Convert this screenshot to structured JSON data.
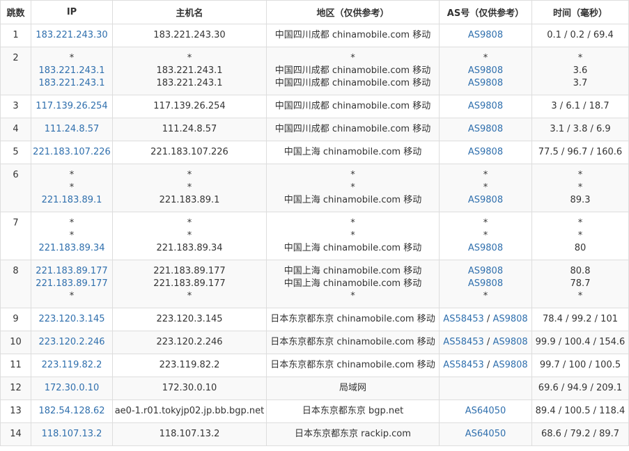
{
  "header": {
    "hop": "跳数",
    "ip": "IP",
    "host": "主机名",
    "region": "地区（仅供参考）",
    "as": "AS号（仅供参考）",
    "time": "时间（毫秒）"
  },
  "rows": [
    {
      "hop": "1",
      "lines": [
        {
          "ip": "183.221.243.30",
          "host": "183.221.243.30",
          "region": "中国四川成都 chinamobile.com 移动",
          "as": [
            "AS9808"
          ],
          "time": "0.1 / 0.2 / 69.4"
        }
      ]
    },
    {
      "hop": "2",
      "lines": [
        {
          "ip": "*",
          "host": "*",
          "region": "*",
          "as": [
            "*"
          ],
          "time": "*"
        },
        {
          "ip": "183.221.243.1",
          "host": "183.221.243.1",
          "region": "中国四川成都 chinamobile.com 移动",
          "as": [
            "AS9808"
          ],
          "time": "3.6"
        },
        {
          "ip": "183.221.243.1",
          "host": "183.221.243.1",
          "region": "中国四川成都 chinamobile.com 移动",
          "as": [
            "AS9808"
          ],
          "time": "3.7"
        }
      ]
    },
    {
      "hop": "3",
      "lines": [
        {
          "ip": "117.139.26.254",
          "host": "117.139.26.254",
          "region": "中国四川成都 chinamobile.com 移动",
          "as": [
            "AS9808"
          ],
          "time": "3 / 6.1 / 18.7"
        }
      ]
    },
    {
      "hop": "4",
      "lines": [
        {
          "ip": "111.24.8.57",
          "host": "111.24.8.57",
          "region": "中国四川成都 chinamobile.com 移动",
          "as": [
            "AS9808"
          ],
          "time": "3.1 / 3.8 / 6.9"
        }
      ]
    },
    {
      "hop": "5",
      "lines": [
        {
          "ip": "221.183.107.226",
          "host": "221.183.107.226",
          "region": "中国上海 chinamobile.com 移动",
          "as": [
            "AS9808"
          ],
          "time": "77.5 / 96.7 / 160.6"
        }
      ]
    },
    {
      "hop": "6",
      "lines": [
        {
          "ip": "*",
          "host": "*",
          "region": "*",
          "as": [
            "*"
          ],
          "time": "*"
        },
        {
          "ip": "*",
          "host": "*",
          "region": "*",
          "as": [
            "*"
          ],
          "time": "*"
        },
        {
          "ip": "221.183.89.1",
          "host": "221.183.89.1",
          "region": "中国上海 chinamobile.com 移动",
          "as": [
            "AS9808"
          ],
          "time": "89.3"
        }
      ]
    },
    {
      "hop": "7",
      "lines": [
        {
          "ip": "*",
          "host": "*",
          "region": "*",
          "as": [
            "*"
          ],
          "time": "*"
        },
        {
          "ip": "*",
          "host": "*",
          "region": "*",
          "as": [
            "*"
          ],
          "time": "*"
        },
        {
          "ip": "221.183.89.34",
          "host": "221.183.89.34",
          "region": "中国上海 chinamobile.com 移动",
          "as": [
            "AS9808"
          ],
          "time": "80"
        }
      ]
    },
    {
      "hop": "8",
      "lines": [
        {
          "ip": "221.183.89.177",
          "host": "221.183.89.177",
          "region": "中国上海 chinamobile.com 移动",
          "as": [
            "AS9808"
          ],
          "time": "80.8"
        },
        {
          "ip": "221.183.89.177",
          "host": "221.183.89.177",
          "region": "中国上海 chinamobile.com 移动",
          "as": [
            "AS9808"
          ],
          "time": "78.7"
        },
        {
          "ip": "*",
          "host": "*",
          "region": "*",
          "as": [
            "*"
          ],
          "time": "*"
        }
      ]
    },
    {
      "hop": "9",
      "lines": [
        {
          "ip": "223.120.3.145",
          "host": "223.120.3.145",
          "region": "日本东京都东京 chinamobile.com 移动",
          "as": [
            "AS58453",
            "AS9808"
          ],
          "time": "78.4 / 99.2 / 101"
        }
      ]
    },
    {
      "hop": "10",
      "lines": [
        {
          "ip": "223.120.2.246",
          "host": "223.120.2.246",
          "region": "日本东京都东京 chinamobile.com 移动",
          "as": [
            "AS58453",
            "AS9808"
          ],
          "time": "99.9 / 100.4 / 154.6"
        }
      ]
    },
    {
      "hop": "11",
      "lines": [
        {
          "ip": "223.119.82.2",
          "host": "223.119.82.2",
          "region": "日本东京都东京 chinamobile.com 移动",
          "as": [
            "AS58453",
            "AS9808"
          ],
          "time": "99.7 / 100 / 100.5"
        }
      ]
    },
    {
      "hop": "12",
      "lines": [
        {
          "ip": "172.30.0.10",
          "host": "172.30.0.10",
          "region": "局域网",
          "as": [],
          "time": "69.6 / 94.9 / 209.1"
        }
      ]
    },
    {
      "hop": "13",
      "lines": [
        {
          "ip": "182.54.128.62",
          "host": "ae0-1.r01.tokyjp02.jp.bb.bgp.net",
          "region": "日本东京都东京 bgp.net",
          "as": [
            "AS64050"
          ],
          "time": "89.4 / 100.5 / 118.4"
        }
      ]
    },
    {
      "hop": "14",
      "lines": [
        {
          "ip": "118.107.13.2",
          "host": "118.107.13.2",
          "region": "日本东京都东京 rackip.com",
          "as": [
            "AS64050"
          ],
          "time": "68.6 / 79.2 / 89.7"
        }
      ]
    }
  ],
  "colors": {
    "link": "#2f6fad",
    "border": "#dddddd",
    "stripe": "#f9f9f9",
    "text": "#333333"
  }
}
